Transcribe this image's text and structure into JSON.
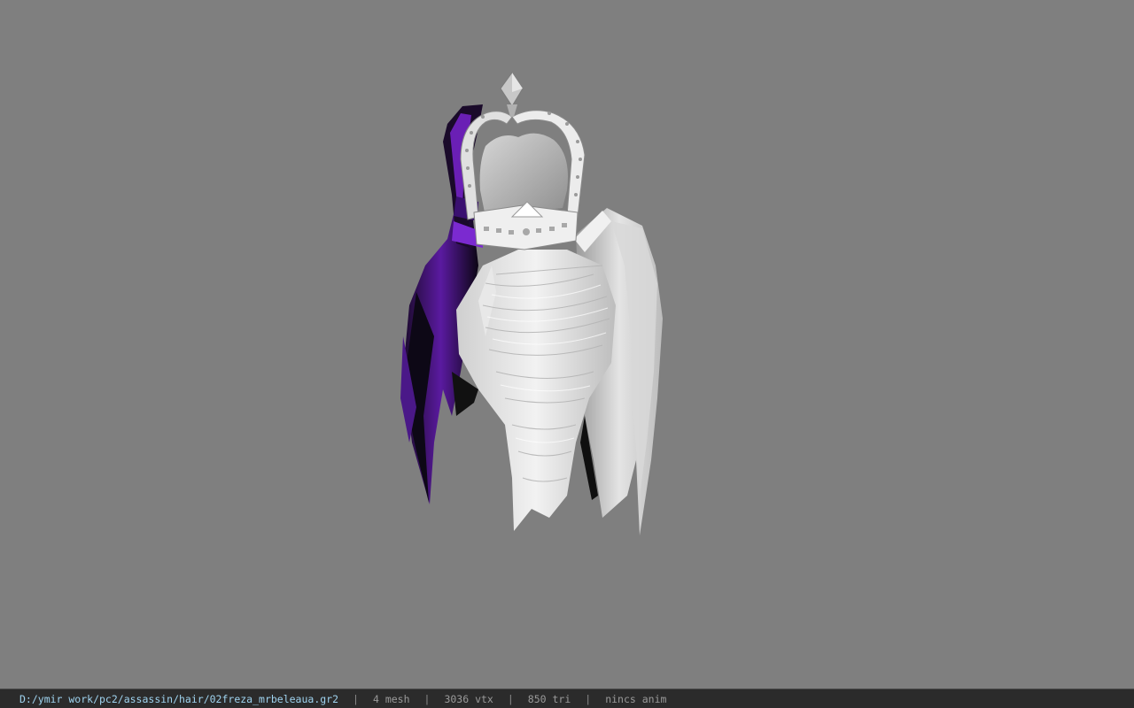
{
  "viewer": {
    "background_color": "#7f7f7f",
    "model_subject": "hair mesh with crown",
    "accent_color": "#6a1fb5"
  },
  "statusbar": {
    "file_path": "D:/ymir work/pc2/assassin/hair/02freza_mrbeleaua.gr2",
    "separator": "|",
    "mesh_count": "4 mesh",
    "vertex_count": "3036 vtx",
    "triangle_count": "850 tri",
    "animation_status": "nincs anim"
  }
}
